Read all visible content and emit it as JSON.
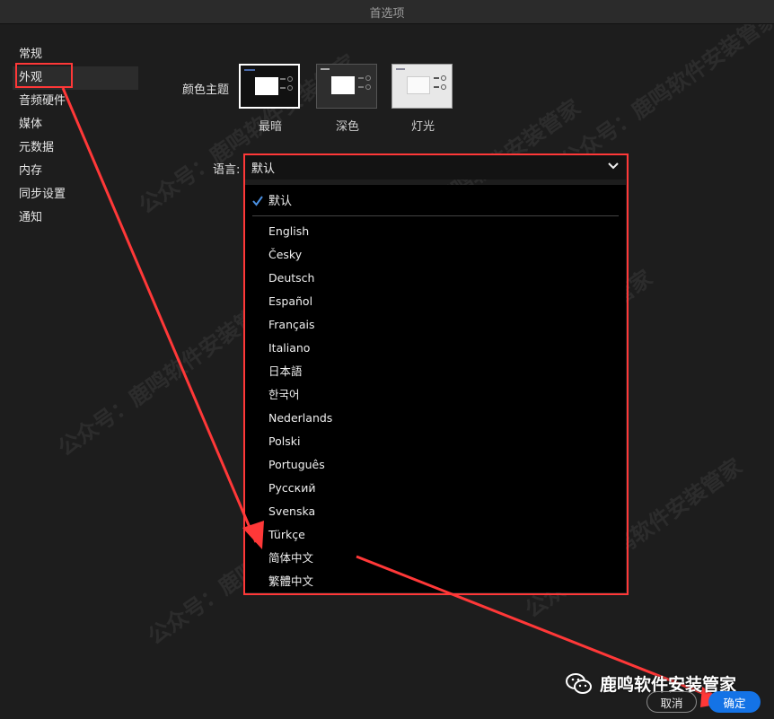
{
  "window": {
    "title": "首选项"
  },
  "sidebar": {
    "items": [
      {
        "label": "常规"
      },
      {
        "label": "外观"
      },
      {
        "label": "音频硬件"
      },
      {
        "label": "媒体"
      },
      {
        "label": "元数据"
      },
      {
        "label": "内存"
      },
      {
        "label": "同步设置"
      },
      {
        "label": "通知"
      }
    ],
    "selected": "外观"
  },
  "appearance": {
    "theme_label": "颜色主题",
    "themes": [
      {
        "name": "最暗",
        "bg": "#111111",
        "selected": true
      },
      {
        "name": "深色",
        "bg": "#2e2e2e",
        "selected": false
      },
      {
        "name": "灯光",
        "bg": "#e8e8e8",
        "selected": false
      }
    ],
    "language_label": "语言:",
    "language_value": "默认"
  },
  "language_menu": {
    "default_label": "默认",
    "options": [
      "English",
      "Česky",
      "Deutsch",
      "Español",
      "Français",
      "Italiano",
      "日本語",
      "한국어",
      "Nederlands",
      "Polski",
      "Português",
      "Русский",
      "Svenska",
      "Türkçe",
      "简体中文",
      "繁體中文"
    ]
  },
  "buttons": {
    "cancel": "取消",
    "ok": "确定"
  },
  "watermark": {
    "brand": "鹿鸣软件安装管家",
    "repeat": "公众号：鹿鸣软件安装管家"
  },
  "colors": {
    "annotation": "#ff3838",
    "accent": "#1473e6"
  }
}
